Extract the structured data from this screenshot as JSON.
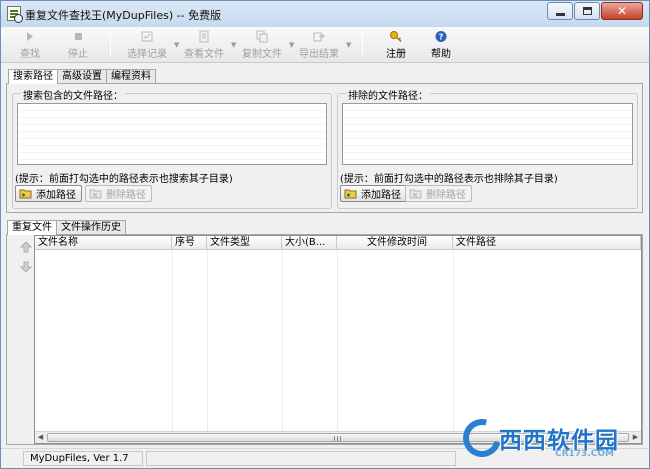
{
  "window": {
    "title": "重复文件查找王(MyDupFiles) -- 免费版"
  },
  "toolbar": {
    "find": "查找",
    "stop": "停止",
    "select_records": "选择记录",
    "view_file": "查看文件",
    "copy_file": "复制文件",
    "export_results": "导出结果",
    "register": "注册",
    "help": "帮助"
  },
  "top_tabs": [
    "搜索路径",
    "高级设置",
    "编程资料"
  ],
  "search_path": {
    "include_group_title": "搜索包含的文件路径：",
    "exclude_group_title": "排除的文件路径：",
    "include_hint": "(提示：前面打勾选中的路径表示也搜索其子目录)",
    "exclude_hint": "(提示：前面打勾选中的路径表示也排除其子目录)",
    "add_path": "添加路径",
    "remove_path": "删除路径"
  },
  "bottom_tabs": [
    "重复文件",
    "文件操作历史"
  ],
  "results": {
    "columns": [
      "文件名称",
      "序号",
      "文件类型",
      "大小(B...",
      "文件修改时间",
      "文件路径"
    ]
  },
  "status": {
    "version": "MyDupFiles, Ver 1.7"
  },
  "watermark": {
    "brand": "西西软件园",
    "domain": "CR173.COM"
  }
}
